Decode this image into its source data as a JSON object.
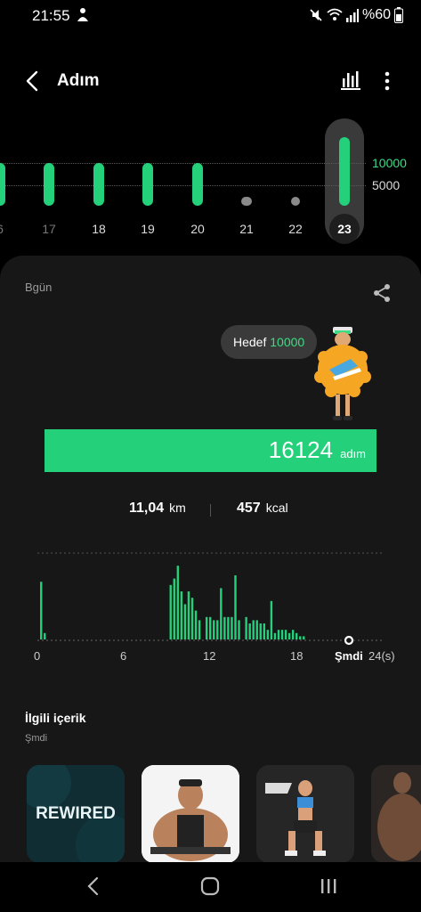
{
  "status_bar": {
    "time": "21:55",
    "battery": "%60",
    "icons": [
      "person-icon",
      "mute-icon",
      "wifi-icon",
      "signal-icon",
      "battery-icon"
    ]
  },
  "header": {
    "title": "Adım",
    "icons": [
      "back-arrow-icon",
      "bar-chart-icon",
      "more-vert-icon"
    ]
  },
  "day_strip": {
    "goal_labels": [
      "10000",
      "5000"
    ],
    "days": [
      {
        "label": "6",
        "level": 1.0,
        "met_goal": true
      },
      {
        "label": "17",
        "level": 1.0,
        "met_goal": true
      },
      {
        "label": "18",
        "level": 1.0,
        "met_goal": true
      },
      {
        "label": "19",
        "level": 1.0,
        "met_goal": true
      },
      {
        "label": "20",
        "level": 1.0,
        "met_goal": true
      },
      {
        "label": "21",
        "level": 0.2,
        "met_goal": false
      },
      {
        "label": "22",
        "level": 0.1,
        "met_goal": false
      },
      {
        "label": "23",
        "level": 1.6,
        "met_goal": true,
        "selected": true
      }
    ]
  },
  "today": {
    "label": "Bgün",
    "goal_prefix": "Hedef",
    "goal_value": "10000",
    "steps": "16124",
    "steps_unit": "adım",
    "progress": 1.0,
    "distance": "11,04",
    "distance_unit": "km",
    "calories": "457",
    "calories_unit": "kcal"
  },
  "hourly": {
    "axis_labels": [
      "0",
      "6",
      "12",
      "18"
    ],
    "now_label": "Şmdi",
    "end_label": "24(s)",
    "levels": [
      0,
      0.9,
      0.1,
      0,
      0,
      0,
      0,
      0,
      0,
      0,
      0,
      0,
      0,
      0,
      0,
      0,
      0,
      0,
      0,
      0,
      0,
      0,
      0,
      0,
      0,
      0,
      0,
      0,
      0,
      0,
      0,
      0,
      0,
      0,
      0,
      0,
      0,
      0.85,
      0.95,
      1.15,
      0.75,
      0.55,
      0.75,
      0.65,
      0.45,
      0.3,
      0,
      0.35,
      0.35,
      0.3,
      0.3,
      0.8,
      0.35,
      0.35,
      0.35,
      1.0,
      0.3,
      0,
      0.35,
      0.25,
      0.3,
      0.3,
      0.25,
      0.25,
      0.15,
      0.6,
      0.1,
      0.15,
      0.15,
      0.15,
      0.1,
      0.15,
      0.1,
      0.05,
      0.05
    ]
  },
  "related": {
    "title": "İlgili içerik",
    "subtitle": "Şmdi",
    "items": [
      {
        "name": "rewired-thumbnail",
        "text": "REWIRED"
      },
      {
        "name": "bodybuilder-thumbnail",
        "text": ""
      },
      {
        "name": "squat-thumbnail",
        "text": ""
      },
      {
        "name": "athlete-thumbnail",
        "text": ""
      }
    ]
  },
  "colors": {
    "accent": "#24d07a",
    "accent_text": "#3ddc84",
    "card": "#171717",
    "idle_bar": "#8a8a8a"
  }
}
